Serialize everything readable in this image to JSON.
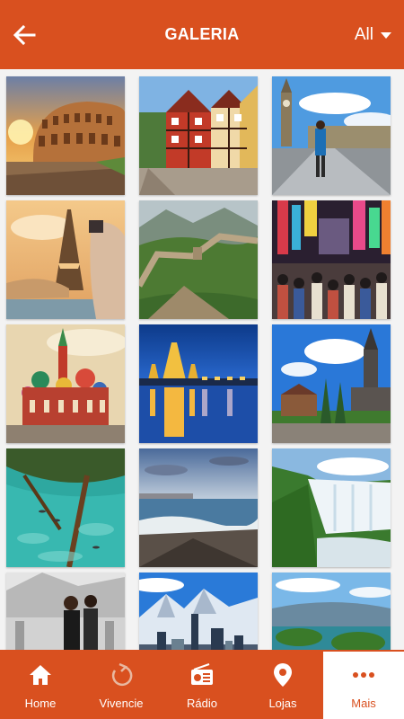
{
  "colors": {
    "accent": "#d9501f",
    "surface": "#f3f3f3",
    "on_accent": "#ffffff"
  },
  "header": {
    "back_icon": "arrow-left-icon",
    "title": "GALERIA",
    "filter": {
      "selected": "All",
      "icon": "caret-down-icon"
    }
  },
  "gallery": {
    "items": [
      {
        "subject": "colosseum"
      },
      {
        "subject": "half-timbered-houses"
      },
      {
        "subject": "big-ben"
      },
      {
        "subject": "eiffel-tower"
      },
      {
        "subject": "great-wall"
      },
      {
        "subject": "city-street-crowd"
      },
      {
        "subject": "saint-basils-cathedral"
      },
      {
        "subject": "temple-at-night"
      },
      {
        "subject": "church-village"
      },
      {
        "subject": "clear-lagoon"
      },
      {
        "subject": "ocean-shore"
      },
      {
        "subject": "waterfalls"
      },
      {
        "subject": "dancing-couple"
      },
      {
        "subject": "snowy-mountain-city"
      },
      {
        "subject": "lake-islands"
      }
    ]
  },
  "bottom_nav": {
    "items": [
      {
        "label": "Home",
        "icon": "home-icon",
        "active": false
      },
      {
        "label": "Vivencie",
        "icon": "refresh-arrow-icon",
        "active": false
      },
      {
        "label": "Rádio",
        "icon": "radio-icon",
        "active": false
      },
      {
        "label": "Lojas",
        "icon": "map-pin-icon",
        "active": false
      },
      {
        "label": "Mais",
        "icon": "more-dots-icon",
        "active": true
      }
    ]
  }
}
